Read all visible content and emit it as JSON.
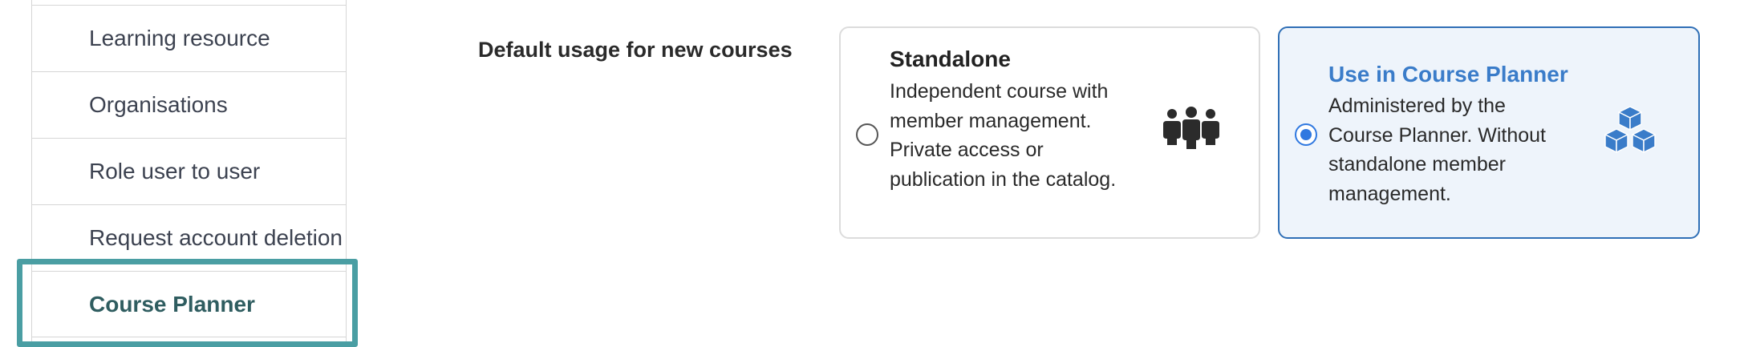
{
  "sidebar": {
    "items": [
      {
        "label": "Learning resource"
      },
      {
        "label": "Organisations"
      },
      {
        "label": "Role user to user"
      },
      {
        "label": "Request account deletion"
      },
      {
        "label": "Course Planner",
        "active": true
      }
    ]
  },
  "main": {
    "field_label": "Default usage for new courses",
    "options": [
      {
        "title": "Standalone",
        "description": "Independent course with member management. Private access or publication in the catalog.",
        "icon": "group-icon",
        "selected": false
      },
      {
        "title": "Use in Course Planner",
        "description": "Administered by the Course Planner. Without standalone member management.",
        "icon": "cubes-icon",
        "selected": true
      }
    ]
  },
  "colors": {
    "accent": "#2f78e0",
    "selected_title": "#3a7cc9",
    "selected_border": "#2f6fb6",
    "selected_background": "#eef4fb",
    "focus_ring": "#4a9ea3",
    "active_nav_text": "#2f5d60"
  }
}
